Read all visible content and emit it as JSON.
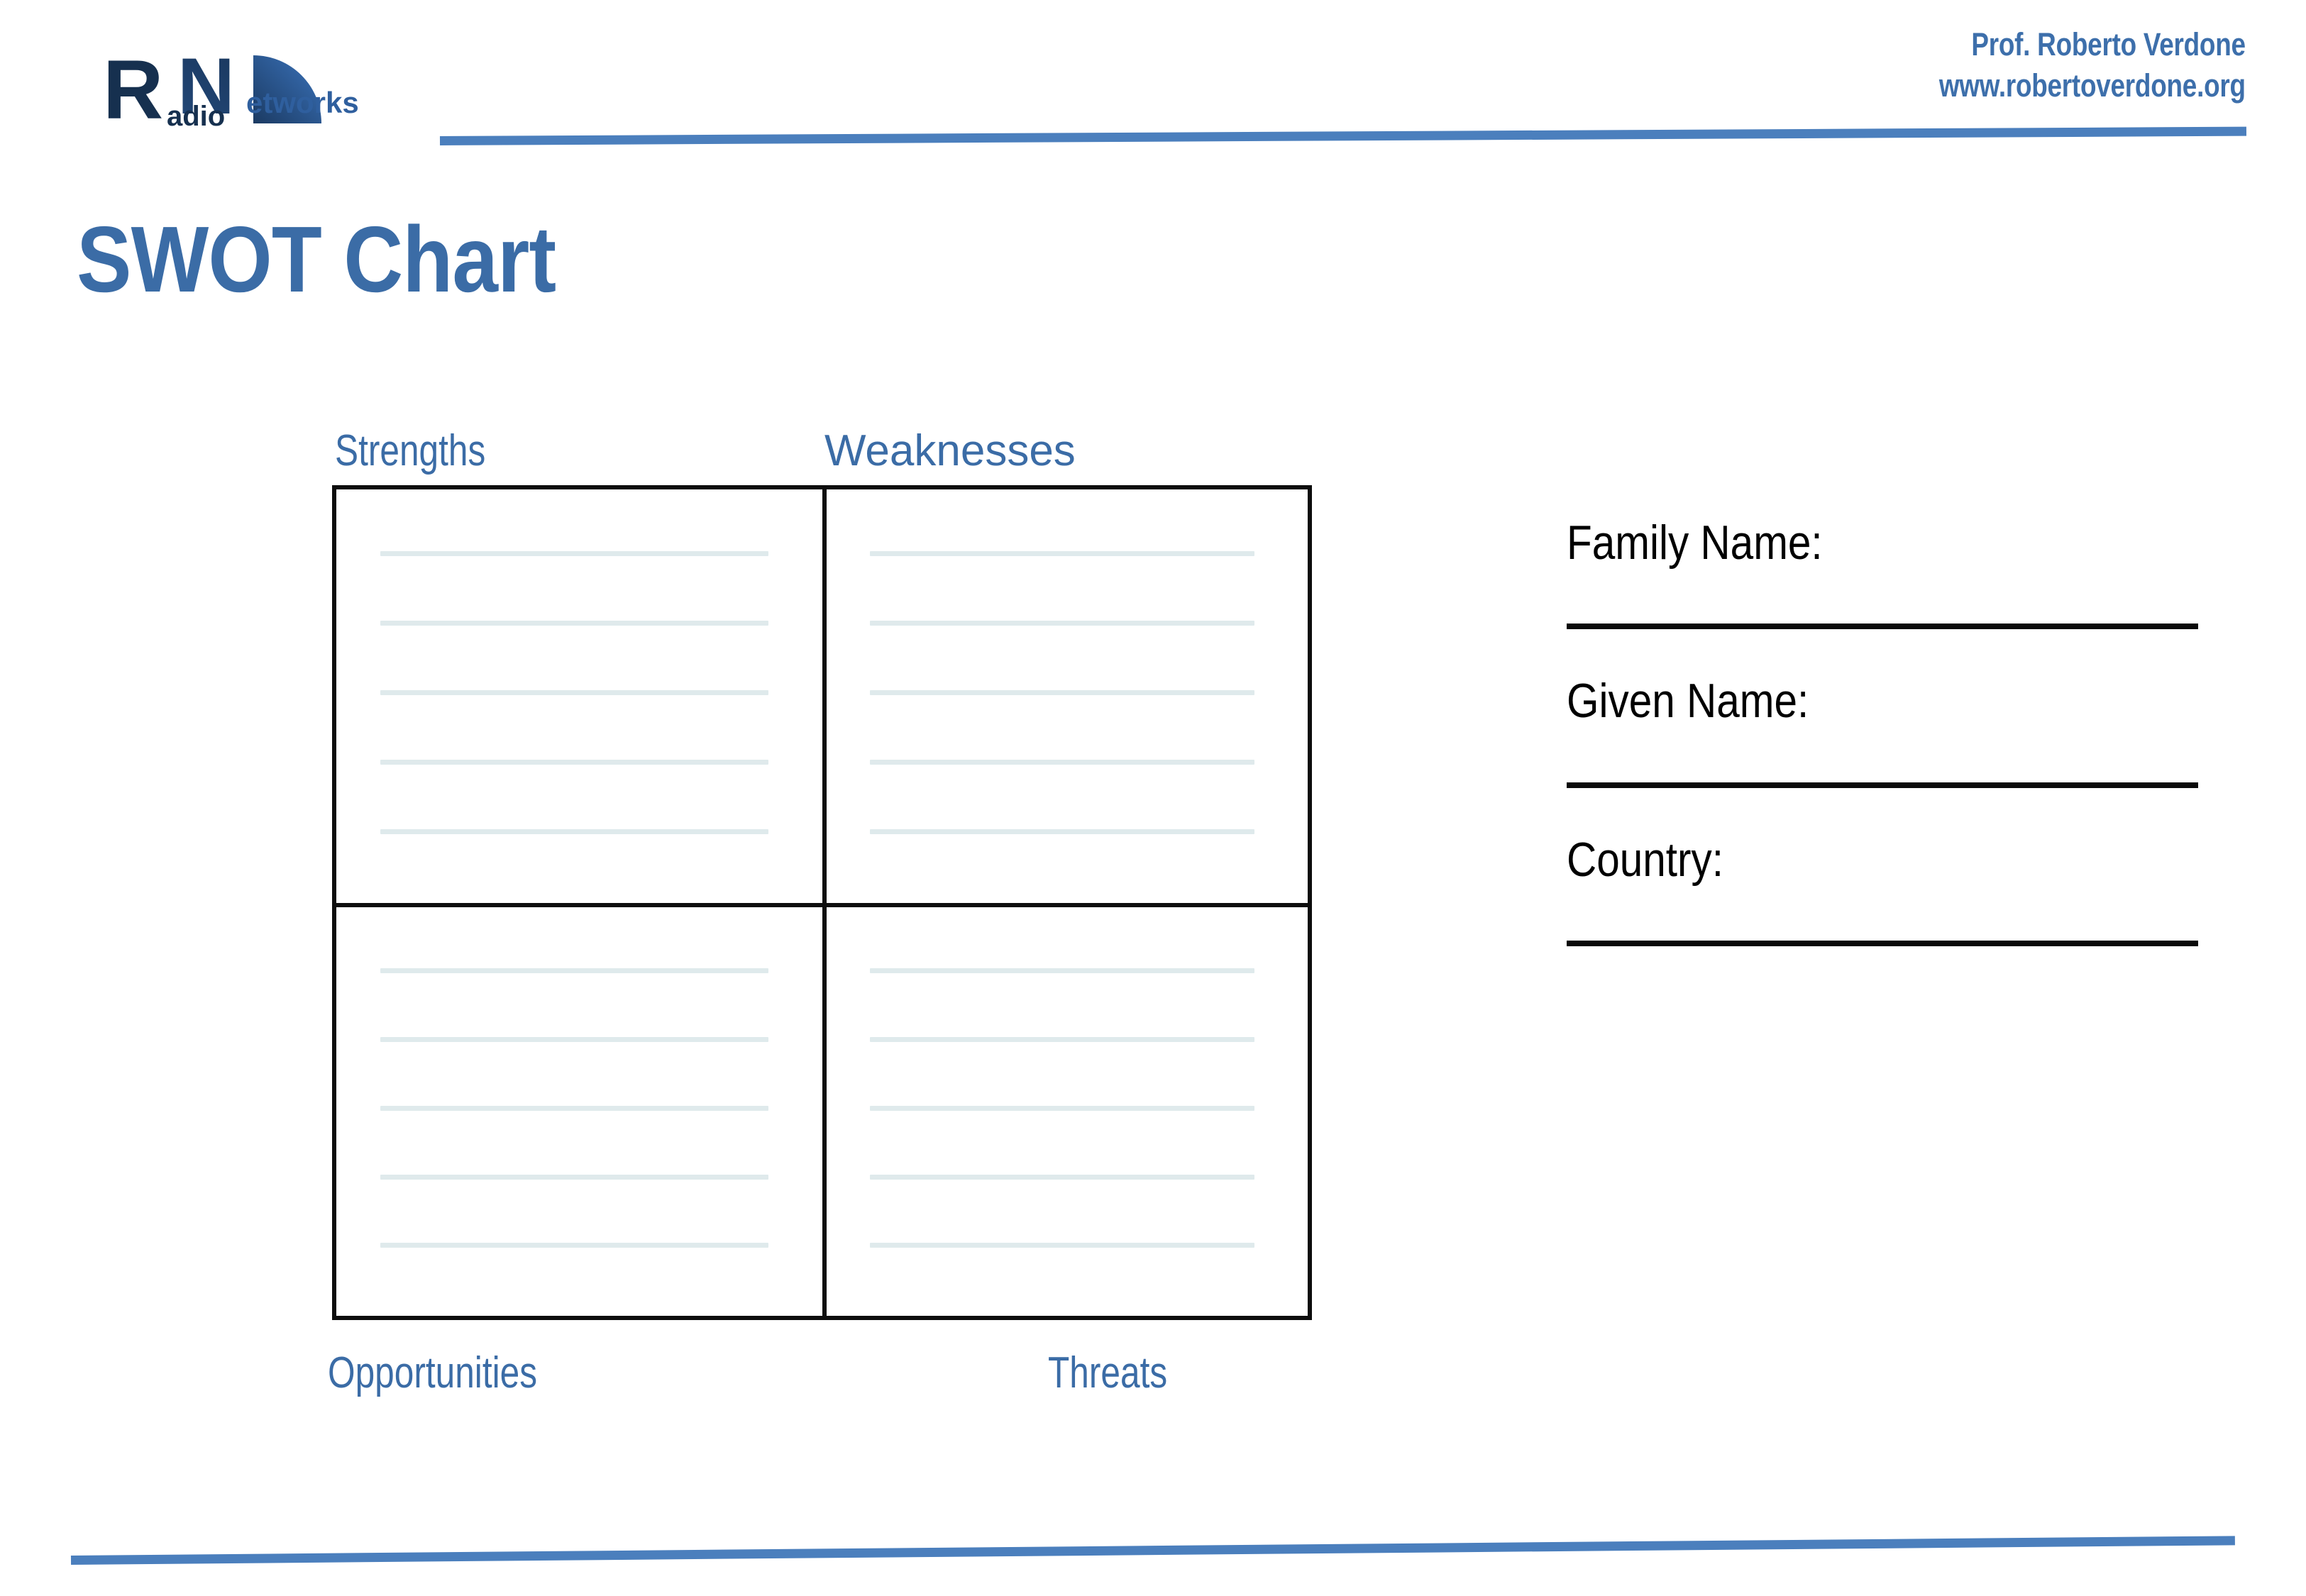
{
  "header": {
    "author": "Prof. Roberto Verdone",
    "website": "www.robertoverdone.org",
    "logo_alt": "Radio Networks logo",
    "logo_text_rn": "RN",
    "logo_text_radio": "adio",
    "logo_text_networks": "etworks"
  },
  "title": "SWOT Chart",
  "swot": {
    "labels": {
      "strengths": "Strengths",
      "weaknesses": "Weaknesses",
      "opportunities": "Opportunities",
      "threats": "Threats"
    },
    "quadrants": [
      {
        "key": "strengths",
        "lines": 5,
        "values": [
          "",
          "",
          "",
          "",
          ""
        ]
      },
      {
        "key": "weaknesses",
        "lines": 5,
        "values": [
          "",
          "",
          "",
          "",
          ""
        ]
      },
      {
        "key": "opportunities",
        "lines": 5,
        "values": [
          "",
          "",
          "",
          "",
          ""
        ]
      },
      {
        "key": "threats",
        "lines": 5,
        "values": [
          "",
          "",
          "",
          "",
          ""
        ]
      }
    ]
  },
  "form": {
    "fields": [
      {
        "label": "Family Name:",
        "value": ""
      },
      {
        "label": "Given Name:",
        "value": ""
      },
      {
        "label": "Country:",
        "value": ""
      }
    ]
  },
  "colors": {
    "brand_blue": "#3b6ca6",
    "rule_blue": "#4b7fbd",
    "logo_dark_navy": "#1b3a62",
    "logo_mid_blue": "#2f5f9e",
    "rule_line": "#dfeaec",
    "box_border": "#0d0d0d",
    "text_black": "#000000"
  }
}
